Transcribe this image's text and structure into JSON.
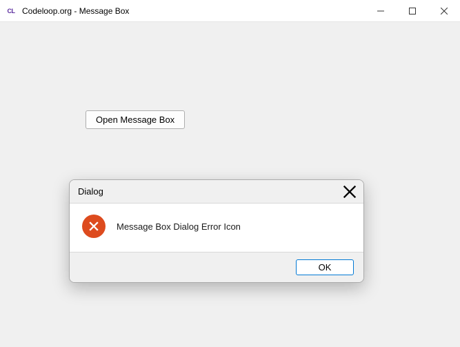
{
  "window": {
    "app_icon_text": "CL",
    "title": "Codeloop.org - Message Box"
  },
  "main": {
    "open_button_label": "Open Message Box"
  },
  "dialog": {
    "title": "Dialog",
    "message": "Message Box Dialog Error Icon",
    "ok_label": "OK"
  }
}
